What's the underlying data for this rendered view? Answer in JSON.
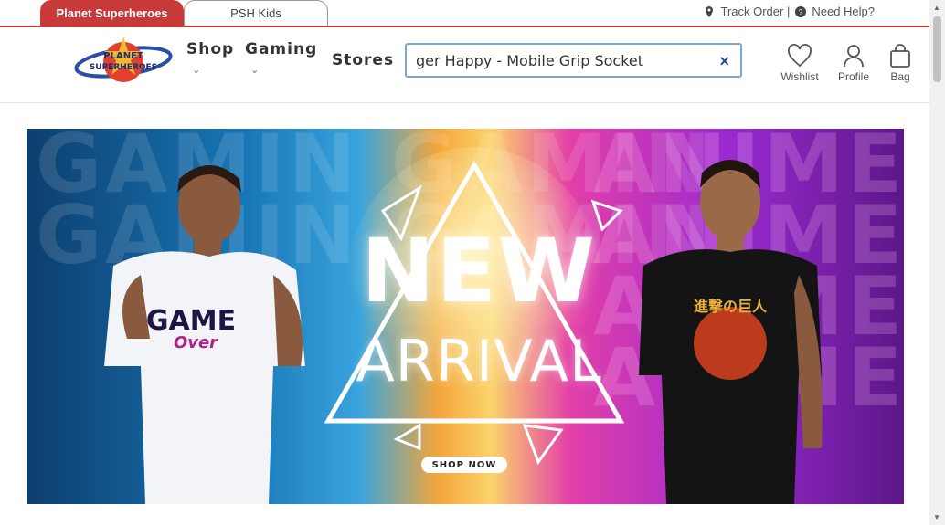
{
  "tabs": {
    "primary": "Planet Superheroes",
    "secondary": "PSH Kids"
  },
  "toplinks": {
    "track": "Track Order |",
    "help": "Need Help?"
  },
  "logo": {
    "line1": "PLANET",
    "line2": "SUPERHEROES"
  },
  "nav": {
    "shop": "Shop",
    "gaming": "Gaming",
    "stores": "Stores"
  },
  "search": {
    "value": "ger Happy - Mobile Grip Socket",
    "clear": "×"
  },
  "header_icons": {
    "wishlist": "Wishlist",
    "profile": "Profile",
    "bag": "Bag"
  },
  "banner": {
    "title1": "NEW",
    "title2": "ARRIVAL",
    "cta": "SHOP NOW",
    "bg_left": "GAMIN GAMIN GAMIN GAMIN",
    "bg_right": "ANIME ANIME ANIME ANIME",
    "tee_left_1": "GAME",
    "tee_left_2": "Over",
    "tee_right": "進撃の巨人"
  },
  "colors": {
    "brand_red": "#c83a3a",
    "search_border": "#7aa7d6"
  }
}
